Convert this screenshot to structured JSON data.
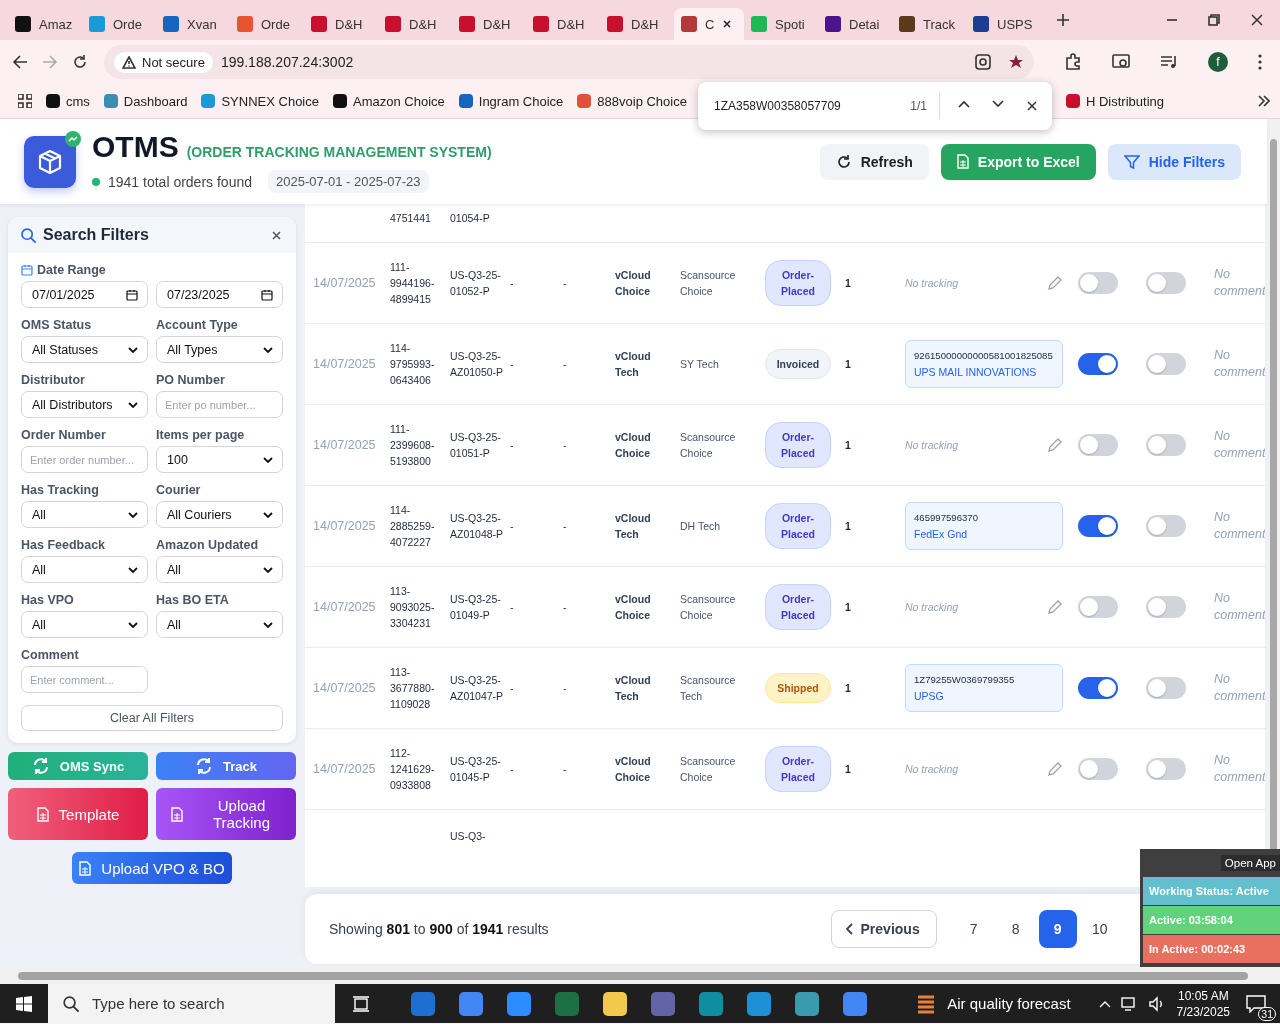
{
  "browser": {
    "tabs": [
      {
        "label": "Amaz",
        "color": "#111111",
        "selected": false
      },
      {
        "label": "Orde",
        "color": "#1a9bd7",
        "selected": false
      },
      {
        "label": "Xvan",
        "color": "#1565c0",
        "selected": false
      },
      {
        "label": "Orde",
        "color": "#e8542f",
        "selected": false
      },
      {
        "label": "D&H",
        "color": "#c8102e",
        "selected": false
      },
      {
        "label": "D&H",
        "color": "#c8102e",
        "selected": false
      },
      {
        "label": "D&H",
        "color": "#c8102e",
        "selected": false
      },
      {
        "label": "D&H",
        "color": "#c8102e",
        "selected": false
      },
      {
        "label": "D&H",
        "color": "#c8102e",
        "selected": false
      },
      {
        "label": "C",
        "color": "#b23a3a",
        "selected": true
      },
      {
        "label": "Spoti",
        "color": "#1db954",
        "selected": false
      },
      {
        "label": "Detai",
        "color": "#4d148c",
        "selected": false
      },
      {
        "label": "Track",
        "color": "#5b3a1a",
        "selected": false
      },
      {
        "label": "USPS",
        "color": "#1b3f8f",
        "selected": false
      }
    ],
    "address": {
      "security": "Not secure",
      "url": "199.188.207.24:3002"
    },
    "profile": "f",
    "bookmarks": [
      {
        "label": "cms",
        "color": "#111111"
      },
      {
        "label": "Dashboard",
        "color": "#3a8fb0"
      },
      {
        "label": "SYNNEX Choice",
        "color": "#1a9bd7"
      },
      {
        "label": "Amazon Choice",
        "color": "#111111"
      },
      {
        "label": "Ingram Choice",
        "color": "#1565c0"
      },
      {
        "label": "888voip Choice",
        "color": "#e0533a"
      },
      {
        "label": "H Distributing",
        "color": "#c8102e"
      }
    ],
    "find_bar": {
      "query": "1ZA358W00358057709",
      "count": "1/1"
    }
  },
  "header": {
    "title": "OTMS",
    "subtitle": "(ORDER TRACKING MANAGEMENT SYSTEM)",
    "summary": "1941 total orders found",
    "date_range": "2025-07-01 - 2025-07-23",
    "buttons": [
      {
        "kind": "refresh",
        "label": "Refresh"
      },
      {
        "kind": "export",
        "label": "Export to Excel"
      },
      {
        "kind": "filters",
        "label": "Hide Filters"
      }
    ]
  },
  "filters": {
    "title": "Search Filters",
    "date_range": {
      "label": "Date Range",
      "from": "07/01/2025",
      "to": "07/23/2025"
    },
    "fields": [
      {
        "kind": "select",
        "label": "OMS Status",
        "value": "All Statuses"
      },
      {
        "kind": "select",
        "label": "Account Type",
        "value": "All Types"
      },
      {
        "kind": "select",
        "label": "Distributor",
        "value": "All Distributors"
      },
      {
        "kind": "input",
        "label": "PO Number",
        "placeholder": "Enter po number..."
      },
      {
        "kind": "input",
        "label": "Order Number",
        "placeholder": "Enter order number..."
      },
      {
        "kind": "select",
        "label": "Items per page",
        "value": "100"
      },
      {
        "kind": "select",
        "label": "Has Tracking",
        "value": "All"
      },
      {
        "kind": "select",
        "label": "Courier",
        "value": "All Couriers"
      },
      {
        "kind": "select",
        "label": "Has Feedback",
        "value": "All"
      },
      {
        "kind": "select",
        "label": "Amazon Updated",
        "value": "All"
      },
      {
        "kind": "select",
        "label": "Has VPO",
        "value": "All"
      },
      {
        "kind": "select",
        "label": "Has BO ETA",
        "value": "All"
      },
      {
        "kind": "input",
        "label": "Comment",
        "placeholder": "Enter comment..."
      }
    ],
    "clear_label": "Clear All Filters"
  },
  "actions": [
    {
      "kind": "sync",
      "label": "OMS Sync"
    },
    {
      "kind": "track",
      "label": "Track"
    },
    {
      "kind": "template",
      "label": "Template"
    },
    {
      "kind": "upload",
      "label": "Upload Tracking"
    },
    {
      "kind": "vpo",
      "label": "Upload VPO & BO"
    }
  ],
  "table": {
    "partial_top": {
      "order_number": "4751441",
      "po_number": "01054-P"
    },
    "rows": [
      {
        "date": "14/07/2025",
        "order_number": "111-9944196-4899415",
        "po_number": "US-Q3-25-01052-P",
        "column_4": "-",
        "column_5": "-",
        "account": "vCloud Choice",
        "distributor": "Scansource Choice",
        "status": {
          "kind": "order_placed",
          "label": "Order-Placed"
        },
        "quantity": "1",
        "tracking": {
          "kind": "none",
          "text": "No tracking"
        },
        "switch_1_on": false,
        "switch_2_on": false,
        "comment": "No comment"
      },
      {
        "date": "14/07/2025",
        "order_number": "114-9795993-0643406",
        "po_number": "US-Q3-25-AZ01050-P",
        "column_4": "-",
        "column_5": "-",
        "account": "vCloud Tech",
        "distributor": "SY Tech",
        "status": {
          "kind": "invoiced",
          "label": "Invoiced"
        },
        "quantity": "1",
        "tracking": {
          "kind": "tracked",
          "number": "92615000000000581001825085",
          "courier": "UPS MAIL INNOVATIONS"
        },
        "switch_1_on": true,
        "switch_2_on": false,
        "comment": "No comment"
      },
      {
        "date": "14/07/2025",
        "order_number": "111-2399608-5193800",
        "po_number": "US-Q3-25-01051-P",
        "column_4": "-",
        "column_5": "-",
        "account": "vCloud Choice",
        "distributor": "Scansource Choice",
        "status": {
          "kind": "order_placed",
          "label": "Order-Placed"
        },
        "quantity": "1",
        "tracking": {
          "kind": "none",
          "text": "No tracking"
        },
        "switch_1_on": false,
        "switch_2_on": false,
        "comment": "No comment"
      },
      {
        "date": "14/07/2025",
        "order_number": "114-2885259-4072227",
        "po_number": "US-Q3-25-AZ01048-P",
        "column_4": "-",
        "column_5": "-",
        "account": "vCloud Tech",
        "distributor": "DH Tech",
        "status": {
          "kind": "order_placed",
          "label": "Order-Placed"
        },
        "quantity": "1",
        "tracking": {
          "kind": "tracked",
          "number": "465997596370",
          "courier": "FedEx Gnd"
        },
        "switch_1_on": true,
        "switch_2_on": false,
        "comment": "No comment"
      },
      {
        "date": "14/07/2025",
        "order_number": "113-9093025-3304231",
        "po_number": "US-Q3-25-01049-P",
        "column_4": "-",
        "column_5": "-",
        "account": "vCloud Choice",
        "distributor": "Scansource Choice",
        "status": {
          "kind": "order_placed",
          "label": "Order-Placed"
        },
        "quantity": "1",
        "tracking": {
          "kind": "none",
          "text": "No tracking"
        },
        "switch_1_on": false,
        "switch_2_on": false,
        "comment": "No comment"
      },
      {
        "date": "14/07/2025",
        "order_number": "113-3677880-1109028",
        "po_number": "US-Q3-25-AZ01047-P",
        "column_4": "-",
        "column_5": "-",
        "account": "vCloud Tech",
        "distributor": "Scansource Tech",
        "status": {
          "kind": "shipped",
          "label": "Shipped"
        },
        "quantity": "1",
        "tracking": {
          "kind": "tracked",
          "number": "1Z79255W0369799355",
          "courier": "UPSG"
        },
        "switch_1_on": true,
        "switch_2_on": false,
        "comment": "No comment"
      },
      {
        "date": "14/07/2025",
        "order_number": "112-1241629-0933808",
        "po_number": "US-Q3-25-01045-P",
        "column_4": "-",
        "column_5": "-",
        "account": "vCloud Choice",
        "distributor": "Scansource Choice",
        "status": {
          "kind": "order_placed",
          "label": "Order-Placed"
        },
        "quantity": "1",
        "tracking": {
          "kind": "none",
          "text": "No tracking"
        },
        "switch_1_on": false,
        "switch_2_on": false,
        "comment": "No comment"
      }
    ],
    "partial_bottom": {
      "po_number": "US-Q3-"
    }
  },
  "pagination": {
    "summary": "Showing **801** to **900** of **1941** results",
    "previous": "Previous",
    "pages": [
      {
        "label": "7",
        "selected": false
      },
      {
        "label": "8",
        "selected": false
      },
      {
        "label": "9",
        "selected": true
      },
      {
        "label": "10",
        "selected": false
      }
    ]
  },
  "overlay": {
    "open_app": "Open App",
    "statuses": [
      {
        "kind": "working",
        "text": "Working Status: Active"
      },
      {
        "kind": "active",
        "text": "Active: 03:58:04"
      },
      {
        "kind": "inactive",
        "text": "In Active: 00:02:43"
      }
    ]
  },
  "taskbar": {
    "search_placeholder": "Type here to search",
    "weather": "Air quality forecast",
    "time": "10:05 AM",
    "date": "7/23/2025",
    "notifications": "31"
  }
}
